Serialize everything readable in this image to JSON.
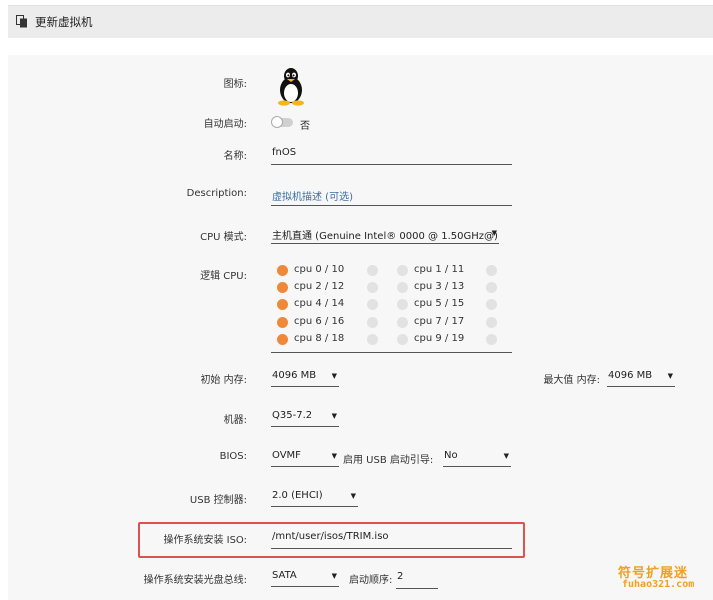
{
  "header": {
    "title": "更新虚拟机",
    "icon": "copy-icon"
  },
  "form": {
    "icon_label": "图标:",
    "icon_name": "linux-tux-icon",
    "autostart_label": "自动启动:",
    "autostart_value": "否",
    "name_label": "名称:",
    "name_value": "fnOS",
    "description_label": "Description:",
    "description_placeholder": "虚拟机描述 (可选)",
    "cpu_mode_label": "CPU 模式:",
    "cpu_mode_value": "主机直通 (Genuine Intel® 0000 @ 1.50GHz@)",
    "logical_cpu_label": "逻辑 CPU:",
    "cpus": [
      {
        "label": "cpu 0 / 10",
        "checked": true,
        "label2": "cpu 1 / 11",
        "checked2": false
      },
      {
        "label": "cpu 2 / 12",
        "checked": true,
        "label2": "cpu 3 / 13",
        "checked2": false
      },
      {
        "label": "cpu 4 / 14",
        "checked": true,
        "label2": "cpu 5 / 15",
        "checked2": false
      },
      {
        "label": "cpu 6 / 16",
        "checked": true,
        "label2": "cpu 7 / 17",
        "checked2": false
      },
      {
        "label": "cpu 8 / 18",
        "checked": true,
        "label2": "cpu 9 / 19",
        "checked2": false
      }
    ],
    "init_mem_label": "初始 内存:",
    "init_mem_value": "4096 MB",
    "max_mem_label": "最大值 内存:",
    "max_mem_value": "4096 MB",
    "machine_label": "机器:",
    "machine_value": "Q35-7.2",
    "bios_label": "BIOS:",
    "bios_value": "OVMF",
    "usb_boot_label": "启用 USB 启动引导:",
    "usb_boot_value": "No",
    "usb_ctrl_label": "USB 控制器:",
    "usb_ctrl_value": "2.0 (EHCI)",
    "os_iso_label": "操作系统安装 ISO:",
    "os_iso_value": "/mnt/user/isos/TRIM.iso",
    "os_bus_label": "操作系统安装光盘总线:",
    "os_bus_value": "SATA",
    "boot_order_label": "启动顺序:",
    "boot_order_value": "2"
  },
  "watermark": {
    "line1": "符号扩展迷",
    "line2": "fuhao321.com"
  },
  "colors": {
    "accent": "#f0883a",
    "highlight": "#d9534f",
    "link": "#3a6ea5"
  }
}
